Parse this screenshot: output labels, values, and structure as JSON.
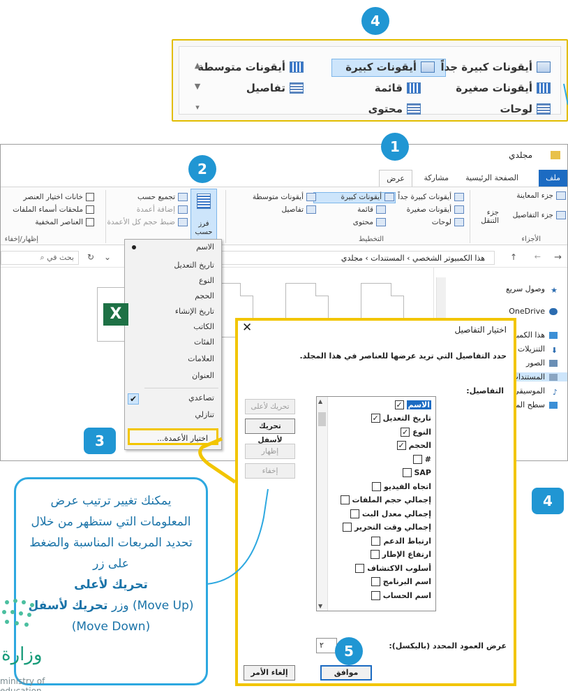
{
  "layout_panel": {
    "items": [
      {
        "label": "أيقونات كبيرة جداً"
      },
      {
        "label": "أيقونات كبيرة"
      },
      {
        "label": "أيقونات متوسطة"
      },
      {
        "label": "أيقونات صغيرة"
      },
      {
        "label": "قائمة"
      },
      {
        "label": "تفاصيل"
      },
      {
        "label": "لوحات"
      },
      {
        "label": "محتوى"
      }
    ]
  },
  "explorer": {
    "title": "مجلدي",
    "tabs": {
      "file": "ملف",
      "home": "الصفحة الرئيسية",
      "share": "مشاركة",
      "view": "عرض"
    },
    "ribbon": {
      "preview_pane": "جزء المعاينة",
      "details_pane": "جزء التفاصيل",
      "nav_pane": "جزء التنقل",
      "panes_group": "الأجزاء",
      "layout_group": "التخطيط",
      "layout_items": [
        "أيقونات كبيرة جداً",
        "أيقونات كبيرة",
        "أيقونات متوسطة",
        "أيقونات صغيرة",
        "قائمة",
        "تفاصيل",
        "لوحات",
        "محتوى"
      ],
      "group_by": "تجميع حسب",
      "add_columns": "إضافة أعمدة",
      "size_columns": "ضبط حجم كل الأعمدة",
      "sort_by": "فرز حسب",
      "item_checkboxes": "خانات اختيار العنصر",
      "file_extensions": "ملحقات أسماء الملفات",
      "hidden_items": "العناصر المخفية",
      "show_hide_group": "إظهار/إخفاء"
    },
    "address": "هذا الكمبيوتر الشخصي  ›  المستندات  ›  مجلدي",
    "search_placeholder": "بحث في",
    "nav": [
      "وصول سريع",
      "OneDrive",
      "هذا الكمبيوتر",
      "التنزيلات",
      "الصور",
      "المستندات",
      "الموسيقى",
      "سطح المكتب"
    ],
    "excel_glyph": "X"
  },
  "sort_menu": {
    "items": [
      "الاسم",
      "تاريخ التعديل",
      "النوع",
      "الحجم",
      "تاريخ الإنشاء",
      "الكاتب",
      "الفئات",
      "العلامات",
      "العنوان"
    ],
    "ascending": "تصاعدي",
    "descending": "تنازلي",
    "choose_columns": "اختيار الأعمدة...",
    "check": "✔"
  },
  "dialog": {
    "title": "اختيار التفاصيل",
    "instruction": "حدد التفاصيل التي تريد عرضها للعناصر في هذا المجلد.",
    "details_label": "التفاصيل:",
    "rows": [
      {
        "label": "الاسم",
        "checked": "✓"
      },
      {
        "label": "تاريخ التعديل",
        "checked": "✓"
      },
      {
        "label": "النوع",
        "checked": "✓"
      },
      {
        "label": "الحجم",
        "checked": "✓"
      },
      {
        "label": "#",
        "checked": ""
      },
      {
        "label": "SAP",
        "checked": ""
      },
      {
        "label": "اتجاه الفيديو",
        "checked": ""
      },
      {
        "label": "إجمالي حجم الملفات",
        "checked": ""
      },
      {
        "label": "إجمالي معدل البت",
        "checked": ""
      },
      {
        "label": "إجمالي وقت التحرير",
        "checked": ""
      },
      {
        "label": "ارتباط الدعم",
        "checked": ""
      },
      {
        "label": "ارتفاع الإطار",
        "checked": ""
      },
      {
        "label": "أسلوب الاكتشاف",
        "checked": ""
      },
      {
        "label": "اسم البرنامج",
        "checked": ""
      },
      {
        "label": "اسم الحساب",
        "checked": ""
      }
    ],
    "move_up": "تحريك لأعلى",
    "move_down": "تحريك لأسفل",
    "show": "إظهار",
    "hide": "إخفاء",
    "width_label": "عرض العمود المحدد (بالبكسل):",
    "width_value": "٢",
    "ok": "موافق",
    "cancel": "إلغاء الأمر"
  },
  "callout": {
    "line1": "يمكنك تغيير ترتيب عرض المعلومات التي ستظهر من خلال تحديد المربعات المناسبة والضغط على زر",
    "move_up_ar": "تحريك لأعلى",
    "move_up_en": "(Move Up)",
    "and_btn": "وزر",
    "move_down_ar": "تحريك لأسفل",
    "move_down_en": "(Move Down)"
  },
  "badges": [
    "4",
    "1",
    "2",
    "3",
    "4",
    "5"
  ],
  "logo": {
    "text": "ministry of education"
  },
  "colors": {
    "accent": "#2096d3",
    "highlight": "#f2c500",
    "selection": "#cde5fb"
  }
}
